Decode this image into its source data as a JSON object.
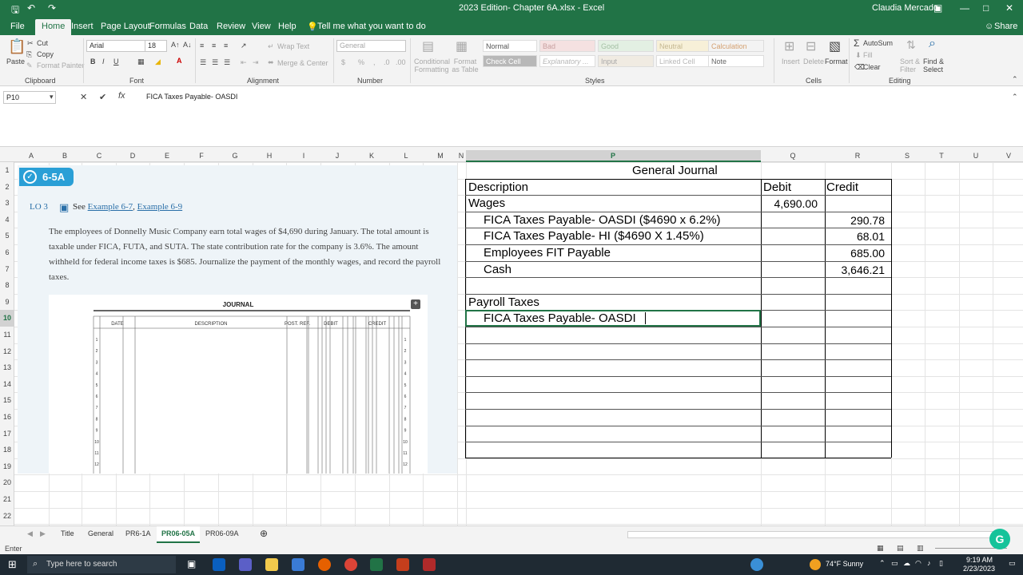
{
  "window": {
    "title": "2023 Edition- Chapter 6A.xlsx - Excel",
    "user": "Claudia Mercado"
  },
  "menu": {
    "tabs": [
      "File",
      "Home",
      "Insert",
      "Page Layout",
      "Formulas",
      "Data",
      "Review",
      "View",
      "Help"
    ],
    "tell_me": "Tell me what you want to do",
    "share": "Share"
  },
  "ribbon": {
    "paste": "Paste",
    "cut": "Cut",
    "copy": "Copy",
    "format_painter": "Format Painter",
    "clipboard": "Clipboard",
    "font_name": "Arial",
    "font_size": "18",
    "font": "Font",
    "wrap_text": "Wrap Text",
    "merge_center": "Merge & Center",
    "alignment": "Alignment",
    "number_format": "General",
    "number": "Number",
    "conditional_formatting": "Conditional Formatting",
    "format_as_table": "Format as Table",
    "styles_label": "Styles",
    "styles": [
      "Normal",
      "Bad",
      "Good",
      "Neutral",
      "Calculation",
      "Check Cell",
      "Explanatory ...",
      "Input",
      "Linked Cell",
      "Note"
    ],
    "insert": "Insert",
    "delete": "Delete",
    "format": "Format",
    "cells": "Cells",
    "autosum": "AutoSum",
    "fill": "Fill",
    "clear": "Clear",
    "sort_filter": "Sort & Filter",
    "find_select": "Find & Select",
    "editing": "Editing"
  },
  "formula_bar": {
    "name_box": "P10",
    "content": "FICA Taxes Payable- OASDI"
  },
  "columns": [
    "A",
    "B",
    "C",
    "D",
    "E",
    "F",
    "G",
    "H",
    "I",
    "J",
    "K",
    "L",
    "M",
    "N",
    "P",
    "Q",
    "R",
    "S",
    "T",
    "U",
    "V"
  ],
  "rows": [
    "1",
    "2",
    "3",
    "4",
    "5",
    "6",
    "7",
    "8",
    "9",
    "10",
    "11",
    "12",
    "13",
    "14",
    "15",
    "16",
    "17",
    "18",
    "19",
    "20",
    "21",
    "22"
  ],
  "selected_cell": {
    "column": "P",
    "row": "10"
  },
  "textbook": {
    "badge": "6-5A",
    "lo": "LO 3",
    "see": "See",
    "example1": "Example 6-7",
    "example2": "Example 6-9",
    "paragraph": "The employees of Donnelly Music Company earn total wages of $4,690 during January. The total amount is taxable under FICA, FUTA, and SUTA. The state contribution rate for the company is 3.6%. The amount withheld for federal income taxes is $685. Journalize the payment of the monthly wages, and record the payroll taxes.",
    "journal_title": "JOURNAL",
    "journal_headers": [
      "DATE",
      "DESCRIPTION",
      "POST. REF.",
      "DEBIT",
      "CREDIT"
    ],
    "line_numbers": [
      "1",
      "2",
      "3",
      "4",
      "5",
      "6",
      "7",
      "8",
      "9",
      "10",
      "11",
      "12"
    ]
  },
  "journal": {
    "title": "General Journal",
    "headers": {
      "description": "Description",
      "debit": "Debit",
      "credit": "Credit"
    },
    "entries": [
      {
        "description": "Wages",
        "debit": "4,690.00",
        "credit": ""
      },
      {
        "description": "FICA Taxes Payable- OASDI ($4690 x 6.2%)",
        "debit": "",
        "credit": "290.78"
      },
      {
        "description": "FICA Taxes Payable- HI ($4690 X 1.45%)",
        "debit": "",
        "credit": "68.01"
      },
      {
        "description": "Employees FIT Payable",
        "debit": "",
        "credit": "685.00"
      },
      {
        "description": "Cash",
        "debit": "",
        "credit": "3,646.21"
      },
      {
        "description": "",
        "debit": "",
        "credit": ""
      },
      {
        "description": "Payroll Taxes",
        "debit": "",
        "credit": ""
      },
      {
        "description": "FICA Taxes Payable- OASDI",
        "debit": "",
        "credit": ""
      }
    ]
  },
  "sheets": [
    "Title",
    "General",
    "PR6-1A",
    "PR06-05A",
    "PR06-09A"
  ],
  "active_sheet": "PR06-05A",
  "status": "Enter",
  "taskbar": {
    "search_placeholder": "Type here to search",
    "weather": "74°F  Sunny",
    "time": "9:19 AM",
    "date": "2/23/2023"
  },
  "colors": {
    "excel_green": "#217346",
    "badge_blue": "#2a9fd6",
    "taskbar": "#1f2a33"
  }
}
